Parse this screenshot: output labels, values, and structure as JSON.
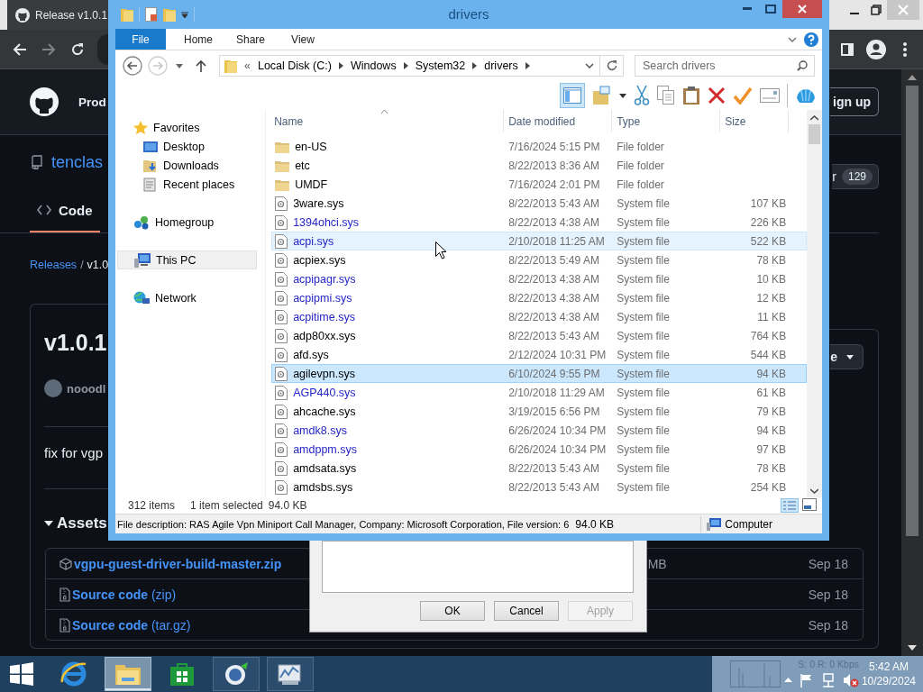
{
  "browser": {
    "tab_title": "Release v1.0.1",
    "header_text": "Prod",
    "signup": "ign up",
    "repo_name": "tenclas",
    "star_label": "r",
    "star_count": "129",
    "code_tab": {
      "label": "Code",
      "selected": true
    },
    "breadcrumb": {
      "link": "Releases",
      "separator": "/",
      "current": "v1.0"
    },
    "release_title": "v1.0.1",
    "author": "nooodl",
    "dropdown_label": "e",
    "body": "fix for vgp",
    "assets_heading": "Assets",
    "assets": [
      {
        "kind": "package",
        "name": "vgpu-guest-driver-build-master.zip",
        "size": "MB",
        "date": "Sep 18"
      },
      {
        "kind": "source",
        "name": "**Source code** (zip)",
        "date": "Sep 18"
      },
      {
        "kind": "source",
        "name": "**Source code** (tar.gz)",
        "date": "Sep 18"
      }
    ]
  },
  "dialog": {
    "buttons": [
      {
        "label": "OK",
        "disabled": false
      },
      {
        "label": "Cancel",
        "disabled": false
      },
      {
        "label": "Apply",
        "disabled": true
      }
    ]
  },
  "explorer": {
    "title": "drivers",
    "ribbon_tabs": [
      {
        "label": "File",
        "kind": "menu"
      },
      {
        "label": "Home",
        "kind": "tab"
      },
      {
        "label": "Share",
        "kind": "tab"
      },
      {
        "label": "View",
        "kind": "tab"
      }
    ],
    "address": {
      "overflow": "«",
      "path": [
        "Local Disk (C:)",
        "Windows",
        "System32",
        "drivers"
      ]
    },
    "search": {
      "placeholder": "Search drivers"
    },
    "nav": [
      {
        "kind": "favorites",
        "label": "Favorites",
        "hovered": false,
        "children": [
          {
            "kind": "desktop",
            "label": "Desktop",
            "hovered": false
          },
          {
            "kind": "downloads",
            "label": "Downloads",
            "hovered": false
          },
          {
            "kind": "recent",
            "label": "Recent places",
            "hovered": false
          }
        ]
      },
      {
        "kind": "homegroup",
        "label": "Homegroup",
        "hovered": false
      },
      {
        "kind": "computer",
        "label": "This PC",
        "hovered": true
      },
      {
        "kind": "network",
        "label": "Network",
        "hovered": false
      }
    ],
    "columns": [
      "Name",
      "Date modified",
      "Type",
      "Size"
    ],
    "files": [
      {
        "kind": "folder",
        "name": "en-US",
        "date": "7/16/2024 5:15 PM",
        "type": "File folder",
        "compressed": false,
        "selected": false,
        "hovered": false
      },
      {
        "kind": "folder",
        "name": "etc",
        "date": "8/22/2013 8:36 AM",
        "type": "File folder",
        "compressed": false,
        "selected": false,
        "hovered": false
      },
      {
        "kind": "folder",
        "name": "UMDF",
        "date": "7/16/2024 2:01 PM",
        "type": "File folder",
        "compressed": false,
        "selected": false,
        "hovered": false
      },
      {
        "kind": "file",
        "name": "3ware.sys",
        "date": "8/22/2013 5:43 AM",
        "type": "System file",
        "size": "107 KB",
        "compressed": false,
        "selected": false,
        "hovered": false
      },
      {
        "kind": "file",
        "name": "1394ohci.sys",
        "date": "8/22/2013 4:38 AM",
        "type": "System file",
        "size": "226 KB",
        "compressed": true,
        "selected": false,
        "hovered": false
      },
      {
        "kind": "file",
        "name": "acpi.sys",
        "date": "2/10/2018 11:25 AM",
        "type": "System file",
        "size": "522 KB",
        "compressed": true,
        "selected": false,
        "hovered": true
      },
      {
        "kind": "file",
        "name": "acpiex.sys",
        "date": "8/22/2013 5:49 AM",
        "type": "System file",
        "size": "78 KB",
        "compressed": false,
        "selected": false,
        "hovered": false
      },
      {
        "kind": "file",
        "name": "acpipagr.sys",
        "date": "8/22/2013 4:38 AM",
        "type": "System file",
        "size": "10 KB",
        "compressed": true,
        "selected": false,
        "hovered": false
      },
      {
        "kind": "file",
        "name": "acpipmi.sys",
        "date": "8/22/2013 4:38 AM",
        "type": "System file",
        "size": "12 KB",
        "compressed": true,
        "selected": false,
        "hovered": false
      },
      {
        "kind": "file",
        "name": "acpitime.sys",
        "date": "8/22/2013 4:38 AM",
        "type": "System file",
        "size": "11 KB",
        "compressed": true,
        "selected": false,
        "hovered": false
      },
      {
        "kind": "file",
        "name": "adp80xx.sys",
        "date": "8/22/2013 5:43 AM",
        "type": "System file",
        "size": "764 KB",
        "compressed": false,
        "selected": false,
        "hovered": false
      },
      {
        "kind": "file",
        "name": "afd.sys",
        "date": "2/12/2024 10:31 PM",
        "type": "System file",
        "size": "544 KB",
        "compressed": false,
        "selected": false,
        "hovered": false
      },
      {
        "kind": "file",
        "name": "agilevpn.sys",
        "date": "6/10/2024 9:55 PM",
        "type": "System file",
        "size": "94 KB",
        "compressed": false,
        "selected": true,
        "hovered": false
      },
      {
        "kind": "file",
        "name": "AGP440.sys",
        "date": "2/10/2018 11:29 AM",
        "type": "System file",
        "size": "61 KB",
        "compressed": true,
        "selected": false,
        "hovered": false
      },
      {
        "kind": "file",
        "name": "ahcache.sys",
        "date": "3/19/2015 6:56 PM",
        "type": "System file",
        "size": "79 KB",
        "compressed": false,
        "selected": false,
        "hovered": false
      },
      {
        "kind": "file",
        "name": "amdk8.sys",
        "date": "6/26/2024 10:34 PM",
        "type": "System file",
        "size": "94 KB",
        "compressed": true,
        "selected": false,
        "hovered": false
      },
      {
        "kind": "file",
        "name": "amdppm.sys",
        "date": "6/26/2024 10:34 PM",
        "type": "System file",
        "size": "97 KB",
        "compressed": true,
        "selected": false,
        "hovered": false
      },
      {
        "kind": "file",
        "name": "amdsata.sys",
        "date": "8/22/2013 5:43 AM",
        "type": "System file",
        "size": "78 KB",
        "compressed": false,
        "selected": false,
        "hovered": false
      },
      {
        "kind": "file",
        "name": "amdsbs.sys",
        "date": "8/22/2013 5:43 AM",
        "type": "System file",
        "size": "254 KB",
        "compressed": false,
        "selected": false,
        "hovered": false
      }
    ],
    "status": {
      "count": "312 items",
      "selection": "1 item selected",
      "selection_size": "94.0 KB"
    },
    "details": {
      "description": "File description: RAS Agile Vpn Miniport Call Manager, Company: Microsoft Corporation, File version: 6",
      "size": "94.0 KB",
      "location": "Computer"
    }
  },
  "taskbar": {
    "apps": [
      {
        "kind": "browser",
        "running": false,
        "active": false
      },
      {
        "kind": "files",
        "running": true,
        "active": true
      },
      {
        "kind": "store",
        "running": false,
        "active": false
      },
      {
        "kind": "globe",
        "running": true,
        "active": false
      },
      {
        "kind": "monitor",
        "running": true,
        "active": false
      }
    ],
    "network_rate": "S: 0 R: 0 Kbps",
    "time": "5:42 AM",
    "date": "10/29/2024"
  }
}
